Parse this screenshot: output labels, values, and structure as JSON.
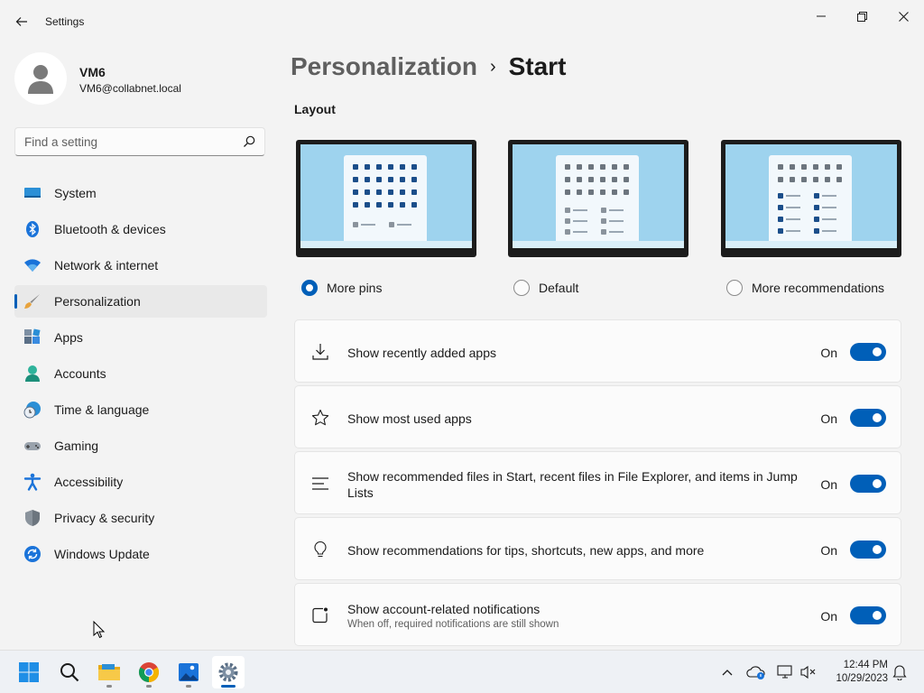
{
  "window": {
    "title": "Settings"
  },
  "profile": {
    "name": "VM6",
    "email": "VM6@collabnet.local"
  },
  "search": {
    "placeholder": "Find a setting"
  },
  "nav": {
    "items": [
      {
        "label": "System",
        "icon": "system-icon"
      },
      {
        "label": "Bluetooth & devices",
        "icon": "bluetooth-icon"
      },
      {
        "label": "Network & internet",
        "icon": "wifi-icon"
      },
      {
        "label": "Personalization",
        "icon": "paintbrush-icon",
        "active": true
      },
      {
        "label": "Apps",
        "icon": "apps-icon"
      },
      {
        "label": "Accounts",
        "icon": "accounts-icon"
      },
      {
        "label": "Time & language",
        "icon": "time-language-icon"
      },
      {
        "label": "Gaming",
        "icon": "gamepad-icon"
      },
      {
        "label": "Accessibility",
        "icon": "accessibility-icon"
      },
      {
        "label": "Privacy & security",
        "icon": "shield-icon"
      },
      {
        "label": "Windows Update",
        "icon": "windows-update-icon"
      }
    ]
  },
  "breadcrumb": {
    "parent": "Personalization",
    "separator": "›",
    "current": "Start"
  },
  "layout": {
    "title": "Layout",
    "options": [
      {
        "label": "More pins",
        "selected": true
      },
      {
        "label": "Default",
        "selected": false
      },
      {
        "label": "More recommendations",
        "selected": false
      }
    ]
  },
  "settings": [
    {
      "title": "Show recently added apps",
      "state": "On",
      "enabled": true,
      "icon": "download-icon"
    },
    {
      "title": "Show most used apps",
      "state": "On",
      "enabled": true,
      "icon": "star-icon"
    },
    {
      "title": "Show recommended files in Start, recent files in File Explorer, and items in Jump Lists",
      "state": "On",
      "enabled": true,
      "icon": "list-icon"
    },
    {
      "title": "Show recommendations for tips, shortcuts, new apps, and more",
      "state": "On",
      "enabled": true,
      "icon": "lightbulb-icon"
    },
    {
      "title": "Show account-related notifications",
      "subtitle": "When off, required notifications are still shown",
      "state": "On",
      "enabled": true,
      "icon": "notification-icon"
    }
  ],
  "taskbar": {
    "apps": [
      "start-icon",
      "search-icon",
      "file-explorer-icon",
      "chrome-icon",
      "photos-icon",
      "settings-icon"
    ],
    "clock": {
      "time": "12:44 PM",
      "date": "10/29/2023"
    }
  },
  "colors": {
    "accent": "#005fb8",
    "background": "#f3f3f3",
    "card": "#fbfbfb"
  }
}
